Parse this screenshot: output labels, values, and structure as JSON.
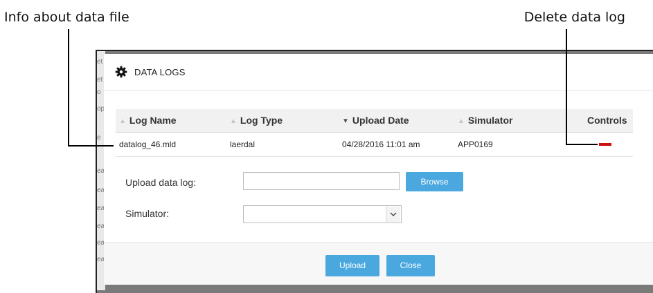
{
  "callouts": {
    "left": "Info about data file",
    "right": "Delete data log"
  },
  "backdrop": {
    "edge_letters": [
      "et",
      "et",
      "o",
      "op",
      "e",
      "ea",
      "ea",
      "ea",
      "ea",
      "ea",
      "ea"
    ]
  },
  "dialog": {
    "title": "DATA LOGS",
    "icon": "gear-icon"
  },
  "table": {
    "headers": [
      "Log Name",
      "Log Type",
      "Upload Date",
      "Simulator",
      "Controls"
    ],
    "rows": [
      {
        "log_name": "datalog_46.mld",
        "log_type": "laerdal",
        "upload_date": "04/28/2016 11:01 am",
        "simulator": "APP0169",
        "control_icon": "minus-icon"
      }
    ]
  },
  "form": {
    "upload_label": "Upload data log:",
    "upload_value": "",
    "browse_label": "Browse",
    "simulator_label": "Simulator:",
    "simulator_value": ""
  },
  "footer": {
    "upload_label": "Upload",
    "close_label": "Close"
  },
  "colors": {
    "accent": "#4aa8df",
    "delete": "#cc1111"
  }
}
